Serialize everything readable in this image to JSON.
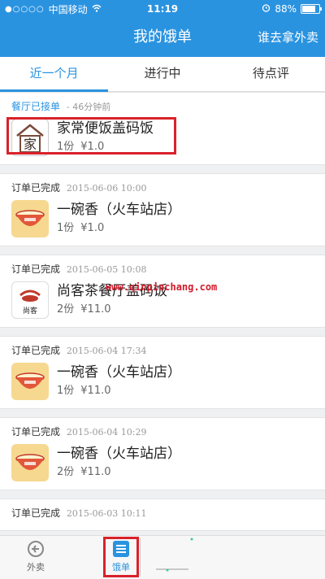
{
  "status_bar": {
    "carrier": "中国移动",
    "time": "11:19",
    "battery": "88%",
    "battery_level": 0.88
  },
  "nav": {
    "title": "我的饿单",
    "action": "谁去拿外卖"
  },
  "tabs": [
    {
      "label": "近一个月",
      "active": true
    },
    {
      "label": "进行中"
    },
    {
      "label": "待点评"
    }
  ],
  "orders": [
    {
      "status": "餐厅已接单",
      "time": "- 46分钟前",
      "shop": "家常便饭盖码饭",
      "qty": "1份",
      "price": "¥1.0",
      "logo": "home-logo"
    },
    {
      "status": "订单已完成",
      "time": "2015-06-06 10:00",
      "shop": "一碗香（火车站店）",
      "qty": "1份",
      "price": "¥1.0",
      "logo": "bowl-logo"
    },
    {
      "status": "订单已完成",
      "time": "2015-06-05 10:08",
      "shop": "尚客茶餐厅盖码饭",
      "qty": "2份",
      "price": "¥11.0",
      "logo": "teahouse-logo"
    },
    {
      "status": "订单已完成",
      "time": "2015-06-04 17:34",
      "shop": "一碗香（火车站店）",
      "qty": "1份",
      "price": "¥11.0",
      "logo": "bowl-logo"
    },
    {
      "status": "订单已完成",
      "time": "2015-06-04 10:29",
      "shop": "一碗香（火车站店）",
      "qty": "2份",
      "price": "¥11.0",
      "logo": "bowl-logo"
    },
    {
      "status": "订单已完成",
      "time": "2015-06-03 10:11"
    }
  ],
  "watermark": "www.qinpinchang.com",
  "tab_bar": {
    "takeout": "外卖",
    "orders": "饿单"
  },
  "colors": {
    "brand": "#2a93e0",
    "highlight": "#d9222a",
    "bowl": "#f6d890"
  }
}
